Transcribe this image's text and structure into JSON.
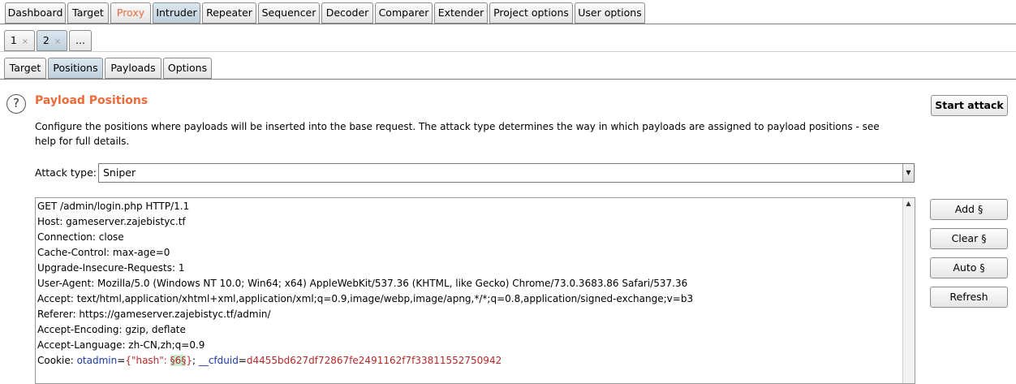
{
  "main_tabs": [
    "Dashboard",
    "Target",
    "Proxy",
    "Intruder",
    "Repeater",
    "Sequencer",
    "Decoder",
    "Comparer",
    "Extender",
    "Project options",
    "User options"
  ],
  "attack_tabs": [
    {
      "label": "1",
      "close": "×"
    },
    {
      "label": "2",
      "close": "×"
    },
    {
      "label": "...",
      "close": ""
    }
  ],
  "sub_tabs": [
    "Target",
    "Positions",
    "Payloads",
    "Options"
  ],
  "section": {
    "help_glyph": "?",
    "title": "Payload Positions",
    "description": "Configure the positions where payloads will be inserted into the base request. The attack type determines the way in which payloads are assigned to payload positions - see help for full details."
  },
  "attack_type": {
    "label": "Attack type:",
    "value": "Sniper"
  },
  "buttons": {
    "start_attack": "Start attack",
    "add": "Add §",
    "clear": "Clear §",
    "auto": "Auto §",
    "refresh": "Refresh"
  },
  "request": {
    "lines": [
      "GET /admin/login.php HTTP/1.1",
      "Host: gameserver.zajebistyc.tf",
      "Connection: close",
      "Cache-Control: max-age=0",
      "Upgrade-Insecure-Requests: 1",
      "User-Agent: Mozilla/5.0 (Windows NT 10.0; Win64; x64) AppleWebKit/537.36 (KHTML, like Gecko) Chrome/73.0.3683.86 Safari/537.36",
      "Accept: text/html,application/xhtml+xml,application/xml;q=0.9,image/webp,image/apng,*/*;q=0.8,application/signed-exchange;v=b3",
      "Referer: https://gameserver.zajebistyc.tf/admin/",
      "Accept-Encoding: gzip, deflate",
      "Accept-Language: zh-CN,zh;q=0.9"
    ],
    "cookie": {
      "prefix": "Cookie: ",
      "name1": "otadmin",
      "eq1": "=",
      "val1_pre": "{\"hash\": ",
      "marker": "§6§",
      "val1_post": "}",
      "sep": "; ",
      "name2": "__cfduid",
      "eq2": "=",
      "val2": "d4455bd627df72867fe2491162f7f33811552750942"
    }
  },
  "colors": {
    "accent_orange": "#ee6a3a",
    "selected_tab": "#c8d8e4",
    "marker_bg": "#c8ecd2"
  }
}
